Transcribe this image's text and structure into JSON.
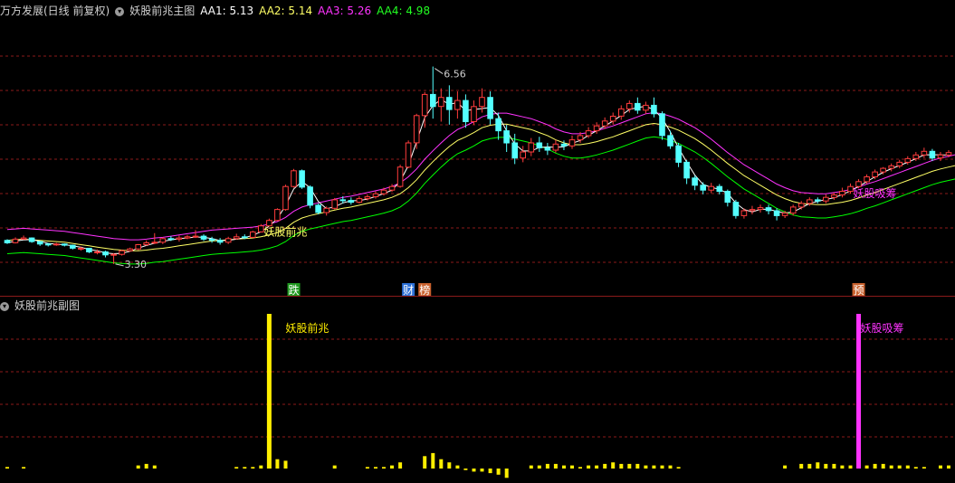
{
  "main_header": {
    "stock": "万方发展(日线 前复权)",
    "indicator": "妖股前兆主图",
    "aa1": "AA1: 5.13",
    "aa2": "AA2: 5.14",
    "aa3": "AA3: 5.26",
    "aa4": "AA4: 4.98"
  },
  "sub_header": {
    "indicator": "妖股前兆副图"
  },
  "colors": {
    "up": "#ff3c3c",
    "down": "#54ffff",
    "aa1": "#ffffff",
    "aa2": "#ffff66",
    "aa3": "#ff33ff",
    "aa4": "#00ff00",
    "grid": "#8b1a1a",
    "signal_yellow": "#ffee00",
    "signal_magenta": "#ff33ff"
  },
  "chart_data": [
    {
      "type": "candlestick",
      "name": "妖股前兆主图",
      "ylim": [
        3.0,
        7.3
      ],
      "grid": true,
      "high_label": "6.56",
      "low_label": "3.30",
      "annotations": [
        {
          "i": 32,
          "text": "妖股前兆",
          "color": "#ffff66"
        },
        {
          "i": 104,
          "text": "妖股吸筹",
          "color": "#ff33ff"
        }
      ],
      "event_tags": [
        {
          "i": 35,
          "text": "跌",
          "bg": "#1f9a1f"
        },
        {
          "i": 49,
          "text": "财",
          "bg": "#2b6fd6"
        },
        {
          "i": 51,
          "text": "榜",
          "bg": "#c8602c"
        },
        {
          "i": 104,
          "text": "预",
          "bg": "#c8602c"
        }
      ],
      "ohlc": [
        [
          3.69,
          3.65,
          3.71,
          3.63
        ],
        [
          3.65,
          3.71,
          3.74,
          3.64
        ],
        [
          3.71,
          3.73,
          3.77,
          3.7
        ],
        [
          3.73,
          3.67,
          3.74,
          3.65
        ],
        [
          3.67,
          3.63,
          3.68,
          3.6
        ],
        [
          3.63,
          3.62,
          3.65,
          3.59
        ],
        [
          3.62,
          3.63,
          3.65,
          3.6
        ],
        [
          3.63,
          3.61,
          3.64,
          3.59
        ],
        [
          3.61,
          3.56,
          3.62,
          3.54
        ],
        [
          3.56,
          3.56,
          3.59,
          3.52
        ],
        [
          3.56,
          3.5,
          3.56,
          3.48
        ],
        [
          3.5,
          3.5,
          3.54,
          3.46
        ],
        [
          3.5,
          3.45,
          3.52,
          3.41
        ],
        [
          3.45,
          3.46,
          3.48,
          3.3
        ],
        [
          3.46,
          3.52,
          3.54,
          3.44
        ],
        [
          3.52,
          3.55,
          3.57,
          3.5
        ],
        [
          3.55,
          3.62,
          3.63,
          3.53
        ],
        [
          3.62,
          3.65,
          3.69,
          3.6
        ],
        [
          3.65,
          3.66,
          3.81,
          3.63
        ],
        [
          3.66,
          3.72,
          3.74,
          3.63
        ],
        [
          3.72,
          3.71,
          3.76,
          3.68
        ],
        [
          3.71,
          3.73,
          3.77,
          3.67
        ],
        [
          3.73,
          3.75,
          3.78,
          3.71
        ],
        [
          3.75,
          3.76,
          3.86,
          3.73
        ],
        [
          3.76,
          3.71,
          3.79,
          3.68
        ],
        [
          3.71,
          3.69,
          3.75,
          3.65
        ],
        [
          3.69,
          3.66,
          3.73,
          3.62
        ],
        [
          3.66,
          3.72,
          3.75,
          3.63
        ],
        [
          3.72,
          3.75,
          3.8,
          3.7
        ],
        [
          3.75,
          3.74,
          3.79,
          3.71
        ],
        [
          3.74,
          3.83,
          3.85,
          3.73
        ],
        [
          3.83,
          3.93,
          3.96,
          3.82
        ],
        [
          3.93,
          4.02,
          4.05,
          3.92
        ],
        [
          4.02,
          4.2,
          4.22,
          4.01
        ],
        [
          4.2,
          4.58,
          4.61,
          4.18
        ],
        [
          4.58,
          4.84,
          4.87,
          4.56
        ],
        [
          4.84,
          4.57,
          4.86,
          4.54
        ],
        [
          4.57,
          4.27,
          4.6,
          4.22
        ],
        [
          4.27,
          4.15,
          4.3,
          4.12
        ],
        [
          4.15,
          4.22,
          4.25,
          4.1
        ],
        [
          4.22,
          4.36,
          4.39,
          4.2
        ],
        [
          4.36,
          4.35,
          4.42,
          4.3
        ],
        [
          4.35,
          4.32,
          4.4,
          4.28
        ],
        [
          4.32,
          4.38,
          4.42,
          4.3
        ],
        [
          4.38,
          4.41,
          4.45,
          4.35
        ],
        [
          4.41,
          4.46,
          4.5,
          4.38
        ],
        [
          4.46,
          4.52,
          4.56,
          4.43
        ],
        [
          4.52,
          4.58,
          4.62,
          4.49
        ],
        [
          4.58,
          4.9,
          4.94,
          4.56
        ],
        [
          4.9,
          5.3,
          5.34,
          4.88
        ],
        [
          5.3,
          5.75,
          5.78,
          5.2
        ],
        [
          5.75,
          6.1,
          6.14,
          5.55
        ],
        [
          6.1,
          5.9,
          6.56,
          5.7
        ],
        [
          5.9,
          6.05,
          6.2,
          5.65
        ],
        [
          6.05,
          5.85,
          6.25,
          5.6
        ],
        [
          5.85,
          6.0,
          6.15,
          5.7
        ],
        [
          6.0,
          5.65,
          6.1,
          5.55
        ],
        [
          5.65,
          5.9,
          6.0,
          5.6
        ],
        [
          5.9,
          6.05,
          6.2,
          5.8
        ],
        [
          6.05,
          5.7,
          6.15,
          5.6
        ],
        [
          5.7,
          5.5,
          5.8,
          5.35
        ],
        [
          5.5,
          5.3,
          5.6,
          5.15
        ],
        [
          5.3,
          5.05,
          5.45,
          4.95
        ],
        [
          5.05,
          5.15,
          5.25,
          4.98
        ],
        [
          5.15,
          5.3,
          5.38,
          5.08
        ],
        [
          5.3,
          5.22,
          5.4,
          5.15
        ],
        [
          5.22,
          5.18,
          5.3,
          5.1
        ],
        [
          5.18,
          5.28,
          5.35,
          5.14
        ],
        [
          5.28,
          5.25,
          5.34,
          5.18
        ],
        [
          5.25,
          5.35,
          5.42,
          5.2
        ],
        [
          5.35,
          5.42,
          5.48,
          5.3
        ],
        [
          5.42,
          5.5,
          5.56,
          5.38
        ],
        [
          5.5,
          5.58,
          5.64,
          5.45
        ],
        [
          5.58,
          5.66,
          5.72,
          5.53
        ],
        [
          5.66,
          5.74,
          5.8,
          5.6
        ],
        [
          5.74,
          5.86,
          5.92,
          5.68
        ],
        [
          5.86,
          5.95,
          6.0,
          5.8
        ],
        [
          5.95,
          5.84,
          6.05,
          5.78
        ],
        [
          5.84,
          5.92,
          5.98,
          5.78
        ],
        [
          5.92,
          5.78,
          6.05,
          5.72
        ],
        [
          5.78,
          5.42,
          5.82,
          5.35
        ],
        [
          5.42,
          5.25,
          5.5,
          5.2
        ],
        [
          5.25,
          4.98,
          5.3,
          4.9
        ],
        [
          4.98,
          4.72,
          5.02,
          4.62
        ],
        [
          4.72,
          4.6,
          4.76,
          4.52
        ],
        [
          4.6,
          4.52,
          4.65,
          4.45
        ],
        [
          4.52,
          4.58,
          4.64,
          4.47
        ],
        [
          4.58,
          4.5,
          4.62,
          4.45
        ],
        [
          4.5,
          4.32,
          4.53,
          4.25
        ],
        [
          4.32,
          4.1,
          4.36,
          4.05
        ],
        [
          4.1,
          4.18,
          4.22,
          4.05
        ],
        [
          4.18,
          4.2,
          4.26,
          4.12
        ],
        [
          4.2,
          4.23,
          4.28,
          4.15
        ],
        [
          4.23,
          4.18,
          4.28,
          4.12
        ],
        [
          4.18,
          4.1,
          4.22,
          4.02
        ],
        [
          4.1,
          4.14,
          4.18,
          4.06
        ],
        [
          4.14,
          4.24,
          4.28,
          4.1
        ],
        [
          4.24,
          4.3,
          4.34,
          4.2
        ],
        [
          4.3,
          4.36,
          4.4,
          4.26
        ],
        [
          4.36,
          4.34,
          4.4,
          4.3
        ],
        [
          4.34,
          4.4,
          4.45,
          4.3
        ],
        [
          4.4,
          4.44,
          4.48,
          4.36
        ],
        [
          4.44,
          4.5,
          4.56,
          4.4
        ],
        [
          4.5,
          4.58,
          4.63,
          4.46
        ],
        [
          4.58,
          4.66,
          4.7,
          4.55
        ],
        [
          4.66,
          4.74,
          4.78,
          4.62
        ],
        [
          4.74,
          4.82,
          4.86,
          4.7
        ],
        [
          4.82,
          4.88,
          4.9,
          4.78
        ],
        [
          4.88,
          4.92,
          4.96,
          4.83
        ],
        [
          4.92,
          4.98,
          5.02,
          4.88
        ],
        [
          4.98,
          5.04,
          5.08,
          4.94
        ],
        [
          5.04,
          5.1,
          5.15,
          5.0
        ],
        [
          5.1,
          5.16,
          5.22,
          5.05
        ],
        [
          5.16,
          5.05,
          5.2,
          5.0
        ],
        [
          5.05,
          5.1,
          5.15,
          5.0
        ],
        [
          5.1,
          5.14,
          5.18,
          5.06
        ]
      ],
      "ma": {
        "AA1": [
          3.69,
          3.7,
          3.71,
          3.7,
          3.69,
          3.68,
          3.67,
          3.66,
          3.64,
          3.62,
          3.6,
          3.58,
          3.56,
          3.54,
          3.53,
          3.52,
          3.52,
          3.53,
          3.55,
          3.56,
          3.58,
          3.6,
          3.62,
          3.64,
          3.66,
          3.68,
          3.69,
          3.7,
          3.71,
          3.72,
          3.73,
          3.75,
          3.78,
          3.82,
          3.89,
          3.99,
          4.06,
          4.1,
          4.13,
          4.16,
          4.19,
          4.22,
          4.24,
          4.27,
          4.3,
          4.33,
          4.36,
          4.4,
          4.46,
          4.56,
          4.69,
          4.85,
          4.99,
          5.12,
          5.24,
          5.34,
          5.4,
          5.47,
          5.55,
          5.59,
          5.61,
          5.61,
          5.58,
          5.55,
          5.52,
          5.47,
          5.42,
          5.35,
          5.3,
          5.27,
          5.27,
          5.29,
          5.32,
          5.36,
          5.4,
          5.45,
          5.5,
          5.55,
          5.6,
          5.62,
          5.6,
          5.56,
          5.51,
          5.44,
          5.37,
          5.28,
          5.18,
          5.07,
          4.96,
          4.86,
          4.76,
          4.68,
          4.6,
          4.52,
          4.44,
          4.38,
          4.33,
          4.3,
          4.29,
          4.28,
          4.28,
          4.3,
          4.32,
          4.35,
          4.39,
          4.44,
          4.48,
          4.53,
          4.58,
          4.63,
          4.68,
          4.73,
          4.78,
          4.83,
          4.87,
          4.9,
          4.93,
          4.96,
          4.98
        ]
      },
      "bands": {
        "AA3_offset": 0.18,
        "AA4_offset": -0.22
      }
    },
    {
      "type": "bar",
      "name": "妖股前兆副图",
      "signals": [
        {
          "i": 32,
          "label": "妖股前兆",
          "value": 100,
          "color": "#ffee00"
        },
        {
          "i": 104,
          "label": "妖股吸筹",
          "value": 100,
          "color": "#ff33ff"
        }
      ],
      "values": [
        1,
        0,
        1,
        0,
        0,
        0,
        0,
        0,
        0,
        0,
        0,
        0,
        0,
        0,
        0,
        0,
        2,
        3,
        2,
        0,
        0,
        0,
        0,
        0,
        0,
        0,
        0,
        0,
        1,
        1,
        1,
        2,
        2,
        6,
        5,
        0,
        0,
        0,
        0,
        0,
        2,
        0,
        0,
        0,
        1,
        1,
        1,
        2,
        4,
        0,
        0,
        8,
        10,
        6,
        4,
        2,
        -1,
        -2,
        -2,
        -3,
        -4,
        -6,
        0,
        0,
        2,
        2,
        3,
        3,
        2,
        2,
        1,
        2,
        2,
        3,
        4,
        3,
        3,
        3,
        2,
        2,
        2,
        2,
        1,
        0,
        0,
        0,
        0,
        0,
        0,
        0,
        0,
        0,
        0,
        0,
        0,
        2,
        0,
        3,
        3,
        4,
        3,
        3,
        2,
        2,
        0,
        2,
        3,
        3,
        2,
        2,
        2,
        1,
        1,
        0,
        2,
        2,
        2,
        1
      ]
    }
  ]
}
